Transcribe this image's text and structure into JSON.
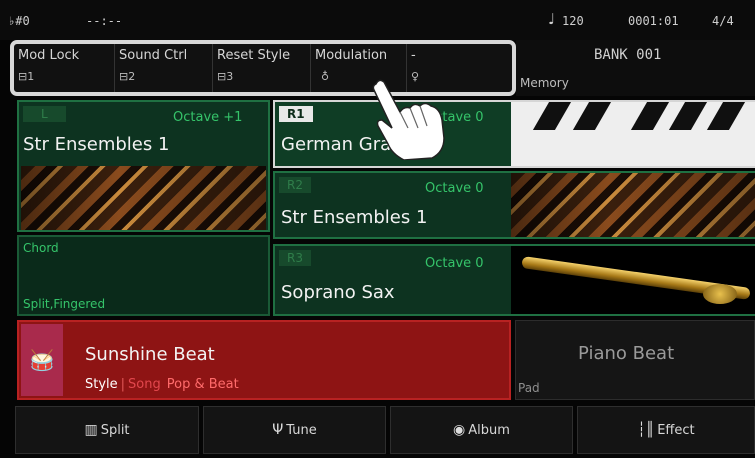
{
  "status": {
    "key": "♭#0",
    "time": "--:--",
    "note_icon": "quarter-note-icon",
    "tempo": "120",
    "measure": "0001:01",
    "beat": "4/4"
  },
  "functions": [
    {
      "label": "Mod Lock",
      "sub": "⊟1"
    },
    {
      "label": "Sound Ctrl",
      "sub": "⊟2"
    },
    {
      "label": "Reset Style",
      "sub": "⊟3"
    },
    {
      "label": "Modulation",
      "sub": "♁"
    },
    {
      "label": "-",
      "sub": "♀"
    }
  ],
  "bank": {
    "name": "BANK 001",
    "memory": "Memory"
  },
  "voices": {
    "left": {
      "tag": "L",
      "octave": "Octave +1",
      "name": "Str Ensembles 1",
      "image": "strings-image"
    },
    "r1": {
      "tag": "R1",
      "octave": "Octave 0",
      "name": "German Grand 1",
      "image": "piano-image"
    },
    "r2": {
      "tag": "R2",
      "octave": "Octave 0",
      "name": "Str Ensembles 1",
      "image": "strings-image"
    },
    "r3": {
      "tag": "R3",
      "octave": "Octave 0",
      "name": "Soprano Sax",
      "image": "sax-image"
    }
  },
  "chord": {
    "title": "Chord",
    "mode": "Split,Fingered"
  },
  "style": {
    "icon": "drum-kit-icon",
    "name": "Sunshine Beat",
    "tab_style": "Style",
    "tab_song": "Song",
    "category": "Pop & Beat"
  },
  "pad": {
    "name": "Piano Beat",
    "label": "Pad"
  },
  "buttons": [
    {
      "label": "Split",
      "icon": "keyboard-icon",
      "glyph": "▥"
    },
    {
      "label": "Tune",
      "icon": "tuning-fork-icon",
      "glyph": "Ψ"
    },
    {
      "label": "Album",
      "icon": "album-disc-icon",
      "glyph": "◉"
    },
    {
      "label": "Effect",
      "icon": "equalizer-icon",
      "glyph": "┆║"
    }
  ],
  "colors": {
    "accent_green": "#35c46a",
    "style_red": "#8e1414",
    "panel_green": "#0d3320"
  }
}
